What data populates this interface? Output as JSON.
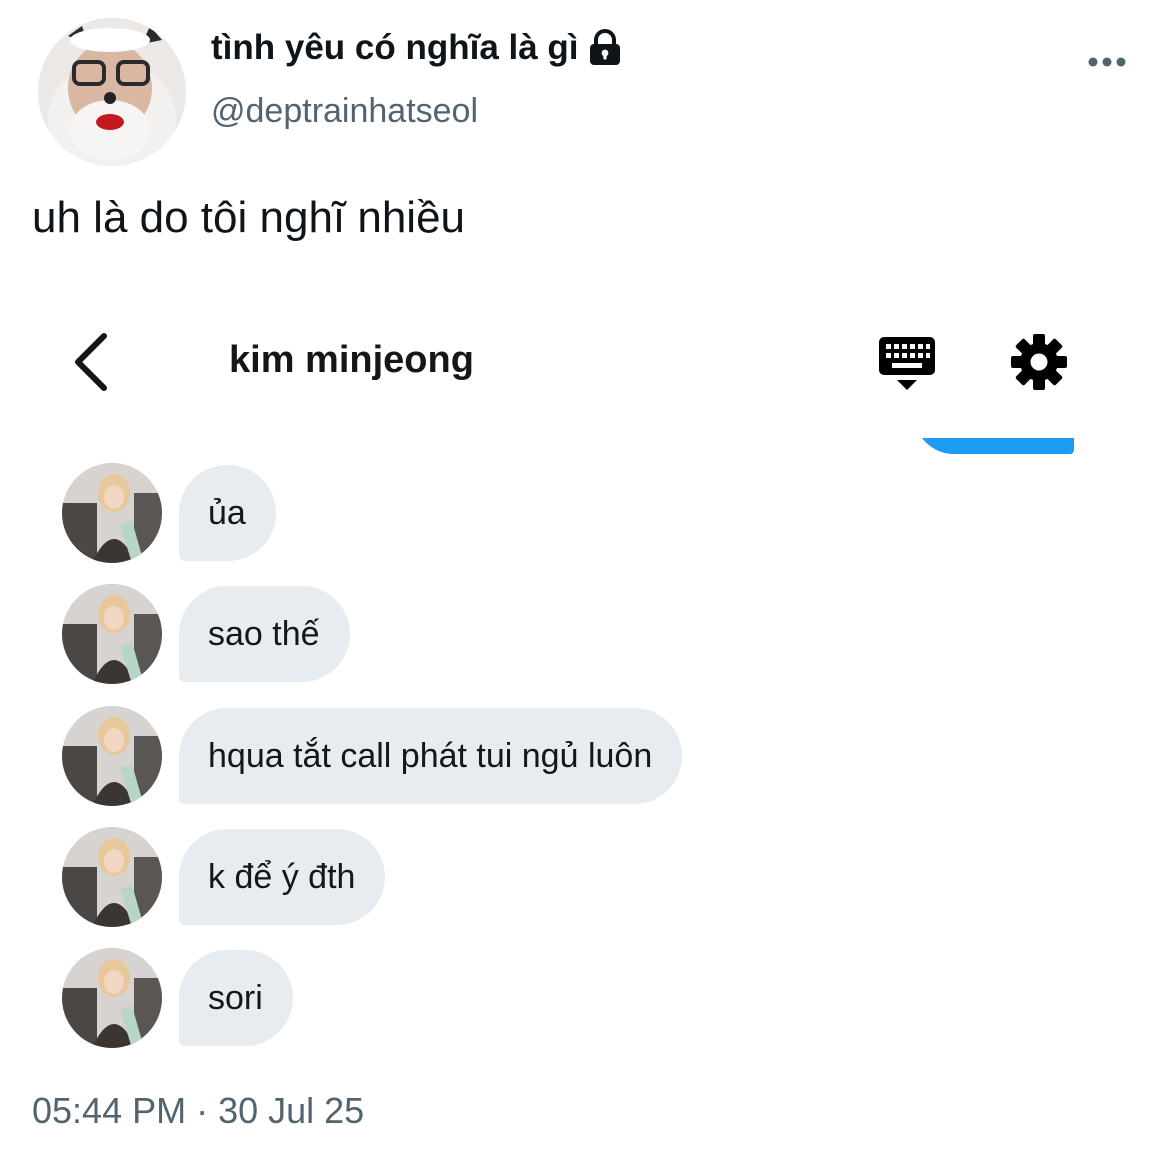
{
  "tweet": {
    "display_name": "tình yêu có nghĩa là gì",
    "handle": "@deptrainhatseol",
    "text": "uh là do tôi nghĩ nhiều",
    "timestamp": "05:44 PM · 30 Jul 25",
    "icons": {
      "lock": "lock-icon",
      "more": "more-horizontal-icon"
    }
  },
  "dm": {
    "title": "kim minjeong",
    "icons": {
      "back": "chevron-left-icon",
      "keyboard": "keyboard-icon",
      "settings": "gear-icon"
    },
    "messages": [
      {
        "text": "ủa"
      },
      {
        "text": "sao thế"
      },
      {
        "text": "hqua tắt call phát tui ngủ luôn"
      },
      {
        "text": "k để ý đth"
      },
      {
        "text": "sori"
      }
    ]
  },
  "colors": {
    "accent_blue": "#1d9bf0",
    "bubble_gray": "#e6ecf0",
    "secondary_text": "#536471",
    "primary_text": "#0f1419"
  }
}
